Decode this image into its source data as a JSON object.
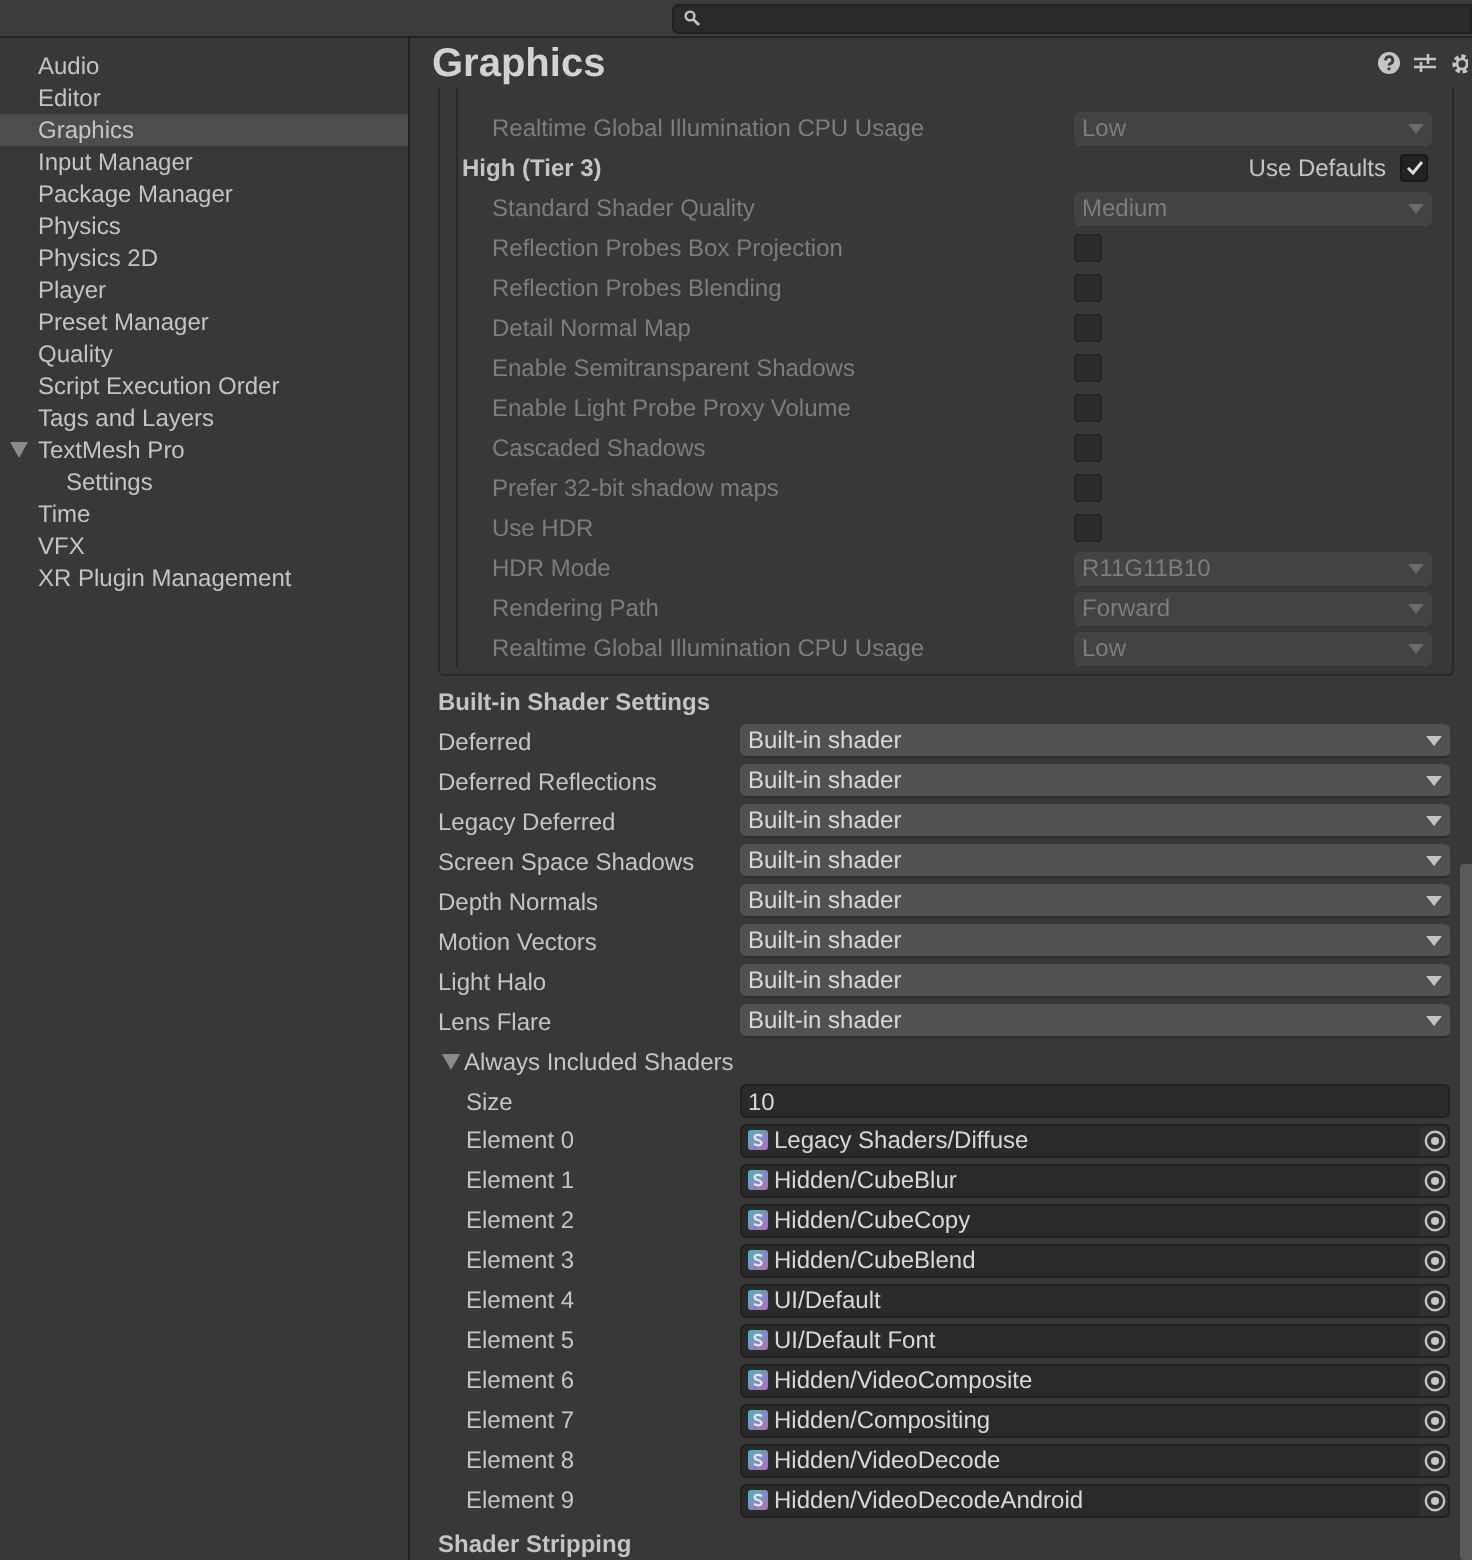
{
  "sidebar": {
    "items": [
      {
        "label": "Audio",
        "selected": false
      },
      {
        "label": "Editor",
        "selected": false
      },
      {
        "label": "Graphics",
        "selected": true
      },
      {
        "label": "Input Manager",
        "selected": false
      },
      {
        "label": "Package Manager",
        "selected": false
      },
      {
        "label": "Physics",
        "selected": false
      },
      {
        "label": "Physics 2D",
        "selected": false
      },
      {
        "label": "Player",
        "selected": false
      },
      {
        "label": "Preset Manager",
        "selected": false
      },
      {
        "label": "Quality",
        "selected": false
      },
      {
        "label": "Script Execution Order",
        "selected": false
      },
      {
        "label": "Tags and Layers",
        "selected": false
      },
      {
        "label": "TextMesh Pro",
        "selected": false,
        "expanded": true,
        "children": [
          {
            "label": "Settings",
            "selected": false
          }
        ]
      },
      {
        "label": "Time",
        "selected": false
      },
      {
        "label": "VFX",
        "selected": false
      },
      {
        "label": "XR Plugin Management",
        "selected": false
      }
    ]
  },
  "inspector": {
    "title": "Graphics",
    "tier": {
      "disabled": true,
      "rows_above": [
        {
          "label": "Realtime Global Illumination CPU Usage",
          "kind": "dropdown",
          "value": "Low"
        }
      ],
      "title": "High (Tier 3)",
      "use_defaults": {
        "label": "Use Defaults",
        "checked": true
      },
      "rows": [
        {
          "label": "Standard Shader Quality",
          "kind": "dropdown",
          "value": "Medium"
        },
        {
          "label": "Reflection Probes Box Projection",
          "kind": "checkbox",
          "checked": false
        },
        {
          "label": "Reflection Probes Blending",
          "kind": "checkbox",
          "checked": false
        },
        {
          "label": "Detail Normal Map",
          "kind": "checkbox",
          "checked": false
        },
        {
          "label": "Enable Semitransparent Shadows",
          "kind": "checkbox",
          "checked": false
        },
        {
          "label": "Enable Light Probe Proxy Volume",
          "kind": "checkbox",
          "checked": false
        },
        {
          "label": "Cascaded Shadows",
          "kind": "checkbox",
          "checked": false
        },
        {
          "label": "Prefer 32-bit shadow maps",
          "kind": "checkbox",
          "checked": false
        },
        {
          "label": "Use HDR",
          "kind": "checkbox",
          "checked": false
        },
        {
          "label": "HDR Mode",
          "kind": "dropdown",
          "value": "R11G11B10"
        },
        {
          "label": "Rendering Path",
          "kind": "dropdown",
          "value": "Forward"
        },
        {
          "label": "Realtime Global Illumination CPU Usage",
          "kind": "dropdown",
          "value": "Low"
        }
      ]
    },
    "builtin_shader_settings": {
      "title": "Built-in Shader Settings",
      "rows": [
        {
          "label": "Deferred",
          "value": "Built-in shader"
        },
        {
          "label": "Deferred Reflections",
          "value": "Built-in shader"
        },
        {
          "label": "Legacy Deferred",
          "value": "Built-in shader"
        },
        {
          "label": "Screen Space Shadows",
          "value": "Built-in shader"
        },
        {
          "label": "Depth Normals",
          "value": "Built-in shader"
        },
        {
          "label": "Motion Vectors",
          "value": "Built-in shader"
        },
        {
          "label": "Light Halo",
          "value": "Built-in shader"
        },
        {
          "label": "Lens Flare",
          "value": "Built-in shader"
        }
      ]
    },
    "always_included_shaders": {
      "title": "Always Included Shaders",
      "expanded": true,
      "size": {
        "label": "Size",
        "value": "10"
      },
      "elements": [
        {
          "label": "Element 0",
          "value": "Legacy Shaders/Diffuse"
        },
        {
          "label": "Element 1",
          "value": "Hidden/CubeBlur"
        },
        {
          "label": "Element 2",
          "value": "Hidden/CubeCopy"
        },
        {
          "label": "Element 3",
          "value": "Hidden/CubeBlend"
        },
        {
          "label": "Element 4",
          "value": "UI/Default"
        },
        {
          "label": "Element 5",
          "value": "UI/Default Font"
        },
        {
          "label": "Element 6",
          "value": "Hidden/VideoComposite"
        },
        {
          "label": "Element 7",
          "value": "Hidden/Compositing"
        },
        {
          "label": "Element 8",
          "value": "Hidden/VideoDecode"
        },
        {
          "label": "Element 9",
          "value": "Hidden/VideoDecodeAndroid"
        }
      ]
    },
    "shader_stripping": {
      "title": "Shader Stripping"
    }
  }
}
